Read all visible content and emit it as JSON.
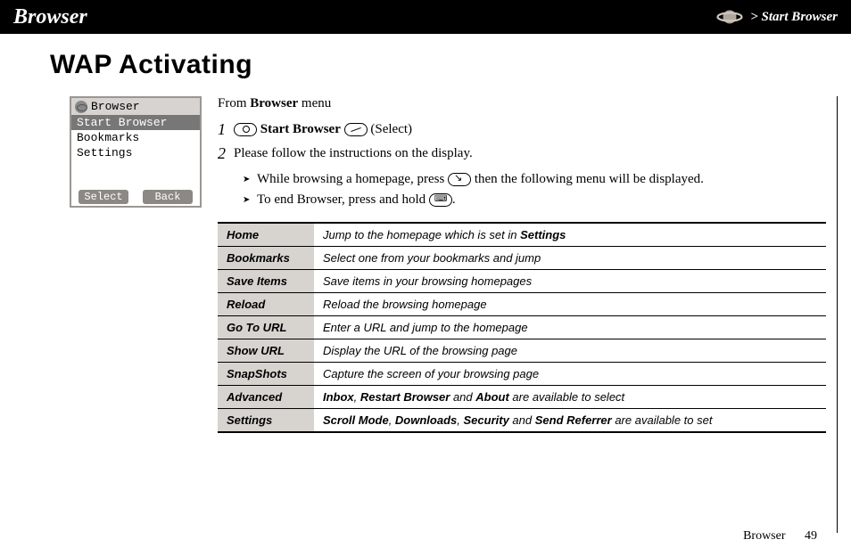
{
  "header": {
    "title": "Browser",
    "breadcrumb": "> Start Browser"
  },
  "page_title": "WAP Activating",
  "phone": {
    "title": "Browser",
    "items": [
      "Start Browser",
      "Bookmarks",
      "Settings"
    ],
    "selected_index": 0,
    "softkeys": {
      "left": "Select",
      "right": "Back"
    }
  },
  "intro": {
    "prefix": "From ",
    "bold": "Browser",
    "suffix": " menu"
  },
  "steps": [
    {
      "n": "1",
      "bold": "Start Browser",
      "suffix": " (Select)"
    },
    {
      "n": "2",
      "text": "Please follow the instructions on the display."
    }
  ],
  "bullets": [
    {
      "pre": "While browsing a homepage, press ",
      "post": " then the following menu will be displayed."
    },
    {
      "pre": "To end Browser, press and hold ",
      "post": "."
    }
  ],
  "table": [
    {
      "label": "Home",
      "desc_pre": "Jump to the homepage which is set in ",
      "desc_bold": "Settings"
    },
    {
      "label": "Bookmarks",
      "desc": "Select one from your bookmarks and jump"
    },
    {
      "label": "Save Items",
      "desc": "Save items in your browsing homepages"
    },
    {
      "label": "Reload",
      "desc": "Reload the browsing homepage"
    },
    {
      "label": "Go To URL",
      "desc": "Enter a URL and jump to the homepage"
    },
    {
      "label": "Show URL",
      "desc": "Display the URL of the browsing page"
    },
    {
      "label": "SnapShots",
      "desc": "Capture the screen of your browsing page"
    },
    {
      "label": "Advanced",
      "adv": {
        "b1": "Inbox",
        "b2": "Restart Browser",
        "b3": "About",
        "tail": " are available to select"
      }
    },
    {
      "label": "Settings",
      "set": {
        "b1": "Scroll Mode",
        "b2": "Downloads",
        "b3": "Security",
        "b4": "Send Referrer",
        "tail": " are available to set"
      }
    }
  ],
  "footer": {
    "section": "Browser",
    "page": "49"
  }
}
